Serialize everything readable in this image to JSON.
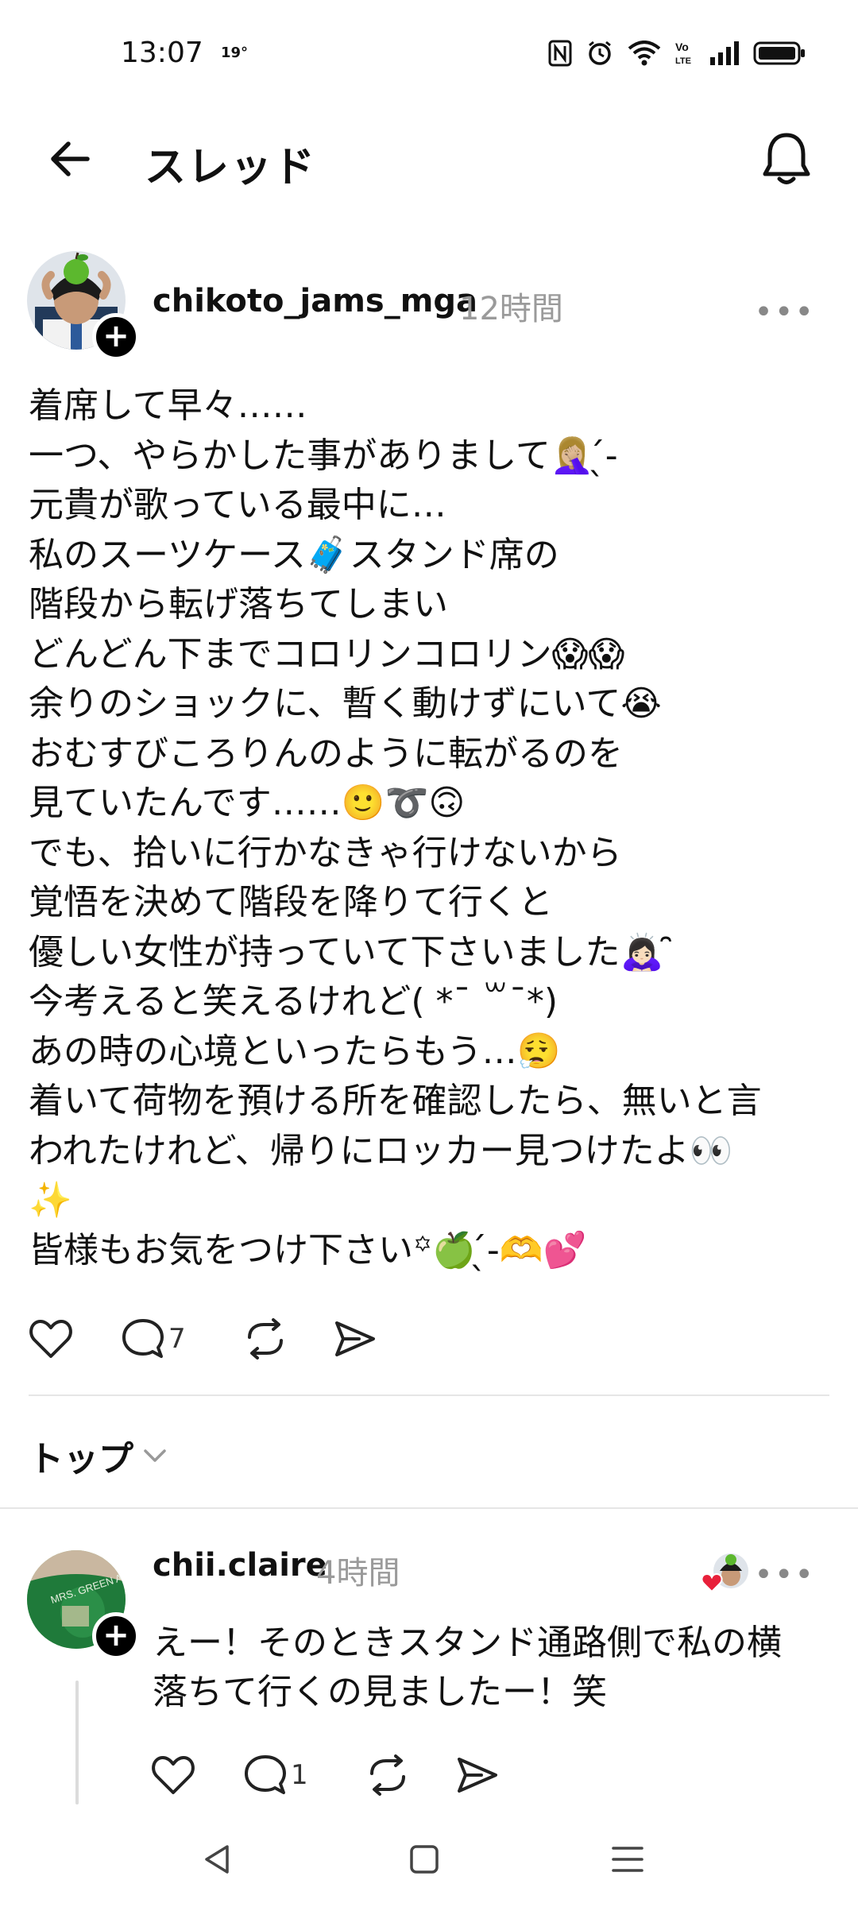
{
  "status_bar": {
    "time": "13:07",
    "temperature": "19°",
    "icons": [
      "nfc-icon",
      "alarm-icon",
      "wifi-icon",
      "volte-icon",
      "signal-icon",
      "battery-icon"
    ],
    "volte_label": "Vo LTE"
  },
  "header": {
    "title": "スレッド",
    "back_icon": "arrow-left-icon",
    "bell_icon": "bell-icon"
  },
  "post": {
    "username": "chikoto_jams_mga",
    "time": "12時間",
    "more_label": "•••",
    "lines": [
      "着席して早々……",
      "一つ、やらかした事がありまして🤦🏼‍♀️ ̖́-",
      "元貴が歌っている最中に…",
      "私のスーツケース🧳スタンド席の",
      "階段から転げ落ちてしまい",
      "どんどん下までコロリンコロリン😱😱",
      "余りのショックに、暫く動けずにいて😭",
      "おむすびころりんのように転がるのを",
      "見ていたんです……🙂➰🙃",
      "でも、拾いに行かなきゃ行けないから",
      "覚悟を決めて階段を降りて行くと",
      "優しい女性が持っていて下さいました🙇🏻‍♀️ ̑̑",
      "今考えると笑えるけれど( *¯ ꒳¯*)",
      "あの時の心境といったらもう…😮‍💨",
      "着いて荷物を預ける所を確認したら、無いと言",
      "われたけれど、帰りにロッカー見つけたよ👀",
      "✨",
      "皆様もお気をつけ下さい꙳🍏 ̖́-🫶💕"
    ],
    "actions": {
      "like_icon": "heart-icon",
      "reply_icon": "comment-icon",
      "reply_count": "7",
      "repost_icon": "repost-icon",
      "share_icon": "send-icon"
    }
  },
  "sort": {
    "label": "トップ",
    "icon": "chevron-down-icon"
  },
  "reply": {
    "username": "chii.claire",
    "time": "4時間",
    "more_label": "•••",
    "text_lines": [
      "えー！そのときスタンド通路側で私の横",
      "落ちて行くの見ましたー！笑"
    ],
    "actions": {
      "reply_count": "1"
    }
  },
  "nav": {
    "back_icon": "triangle-back-icon",
    "home_icon": "square-home-icon",
    "menu_icon": "menu-lines-icon"
  },
  "colors": {
    "text": "#111111",
    "muted": "#9a9a9a",
    "divider": "#e6e6e6",
    "heart_red": "#e8203a"
  }
}
